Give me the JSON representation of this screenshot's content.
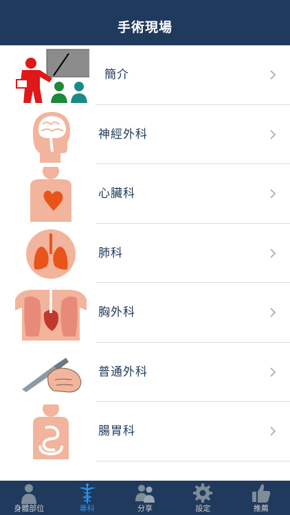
{
  "navbar": {
    "title": "手術現場"
  },
  "list": {
    "items": [
      {
        "label": "簡介",
        "icon": "presentation-icon"
      },
      {
        "label": "神經外科",
        "icon": "brain-head-icon"
      },
      {
        "label": "心臟科",
        "icon": "heart-torso-icon"
      },
      {
        "label": "肺科",
        "icon": "lungs-icon"
      },
      {
        "label": "胸外科",
        "icon": "chest-anatomy-icon"
      },
      {
        "label": "普通外科",
        "icon": "scalpel-hand-icon"
      },
      {
        "label": "腸胃科",
        "icon": "intestine-torso-icon"
      }
    ]
  },
  "tabbar": {
    "tabs": [
      {
        "label": "身體部位",
        "icon": "body-silhouette-icon",
        "active": false
      },
      {
        "label": "專科",
        "icon": "caduceus-icon",
        "active": true
      },
      {
        "label": "分享",
        "icon": "people-icon",
        "active": false
      },
      {
        "label": "設定",
        "icon": "gear-icon",
        "active": false
      },
      {
        "label": "推薦",
        "icon": "thumbs-up-icon",
        "active": false
      }
    ]
  },
  "colors": {
    "navbar_bg": "#1f3a5c",
    "label_text": "#1f3a5c",
    "active_tab": "#2f8ff0",
    "skin": "#f2b49c"
  }
}
